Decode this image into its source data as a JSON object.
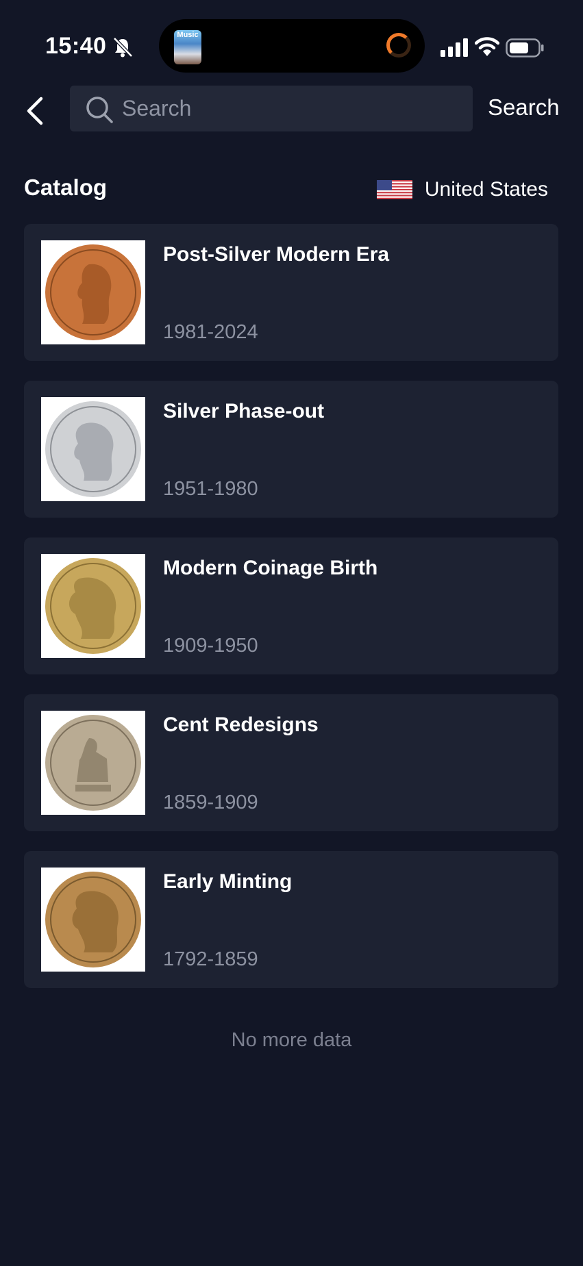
{
  "status_bar": {
    "time": "15:40",
    "now_playing_label": "Music",
    "icons": [
      "bell-slash-icon",
      "signal-icon",
      "wifi-icon",
      "battery-icon"
    ]
  },
  "header": {
    "search_placeholder": "Search",
    "search_button": "Search"
  },
  "catalog": {
    "title": "Catalog",
    "country": "United States"
  },
  "eras": [
    {
      "title": "Post-Silver Modern Era",
      "years": "1981-2024",
      "coin_color": "#c8733a"
    },
    {
      "title": "Silver Phase-out",
      "years": "1951-1980",
      "coin_color": "#cfd1d4"
    },
    {
      "title": "Modern Coinage Birth",
      "years": "1909-1950",
      "coin_color": "#c7a75c"
    },
    {
      "title": "Cent Redesigns",
      "years": "1859-1909",
      "coin_color": "#b9ab93"
    },
    {
      "title": "Early Minting",
      "years": "1792-1859",
      "coin_color": "#b98a4e"
    }
  ],
  "footer": {
    "no_more": "No more data"
  }
}
